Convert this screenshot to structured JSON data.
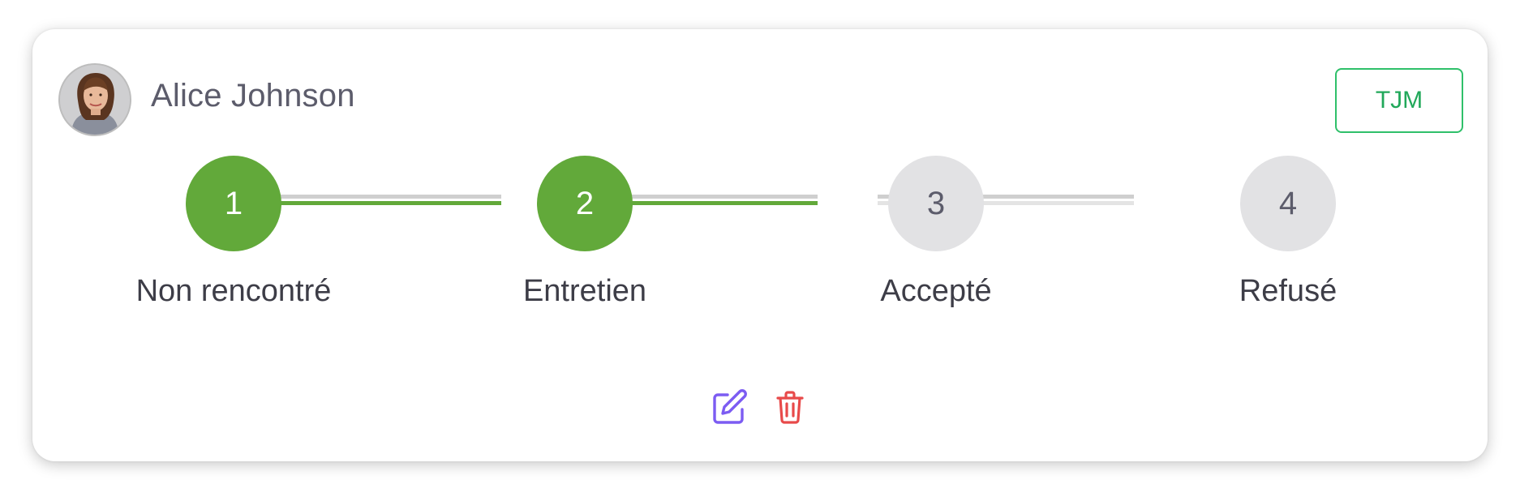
{
  "candidate": {
    "name": "Alice Johnson",
    "rate_button_label": "TJM"
  },
  "steps": [
    {
      "number": "1",
      "label": "Non rencontré",
      "status": "done"
    },
    {
      "number": "2",
      "label": "Entretien",
      "status": "done"
    },
    {
      "number": "3",
      "label": "Accepté",
      "status": "todo"
    },
    {
      "number": "4",
      "label": "Refusé",
      "status": "todo"
    }
  ],
  "actions": {
    "edit_icon": "edit-icon",
    "delete_icon": "trash-icon"
  },
  "colors": {
    "success": "#62a93a",
    "accent_green": "#2fc06a",
    "edit": "#7c5cf2",
    "delete": "#e84a4a",
    "inactive": "#e2e2e4"
  }
}
